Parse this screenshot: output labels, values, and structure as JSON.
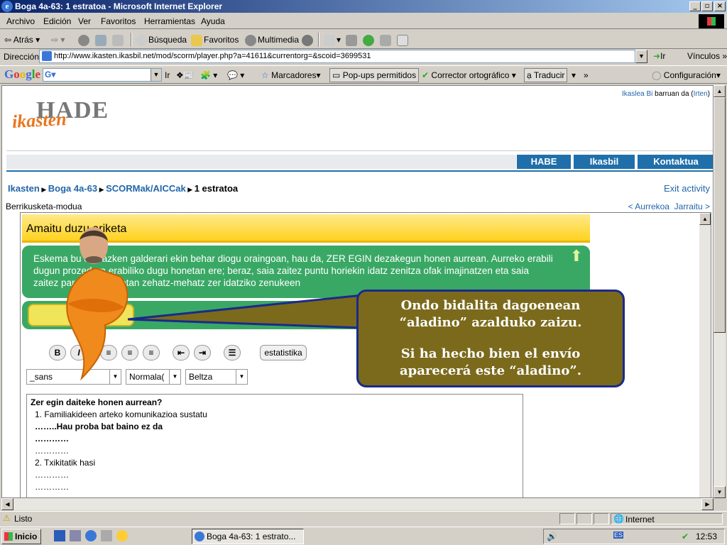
{
  "window": {
    "title": "Boga 4a-63: 1 estratoa - Microsoft Internet Explorer",
    "controls": [
      "_",
      "▫",
      "×"
    ]
  },
  "menu": [
    "Archivo",
    "Edición",
    "Ver",
    "Favoritos",
    "Herramientas",
    "Ayuda"
  ],
  "toolbar": {
    "back": "Atrás",
    "search": "Búsqueda",
    "favorites": "Favoritos",
    "media": "Multimedia"
  },
  "address": {
    "label": "Dirección",
    "url": "http://www.ikasten.ikasbil.net/mod/scorm/player.php?a=41611&currentorg=&scoid=3699531",
    "go": "Ir",
    "links": "Vínculos"
  },
  "google_bar": {
    "logo": "Google",
    "go": "Ir",
    "bookmarks": "Marcadores",
    "popups": "Pop-ups permitidos",
    "spell": "Corrector ortográfico",
    "translate": "Traducir",
    "settings": "Configuración"
  },
  "site": {
    "logo_hade": "HADE",
    "logo_ikasten": "ikasten",
    "user_prefix": "Ikaslea Bi",
    "user_mid": "barruan da (",
    "logout": "Irten",
    "user_suffix": ")",
    "tabs": [
      "HABE",
      "Ikasbil",
      "Kontaktua"
    ],
    "breadcrumbs": [
      "Ikasten",
      "Boga 4a-63",
      "SCORMak/AICCak",
      "1 estratoa"
    ],
    "exit": "Exit activity",
    "mode": "Berrikusketa-modua",
    "prev": "< Aurrekoa",
    "next": "Jarraitu >"
  },
  "lesson": {
    "header": "Amaitu duzu ariketa",
    "instruction": "Eskema bu      eko azken galderari ekin behar diogu oraingoan, hau da, ZER EGIN dezakegun honen aurrean. Aurreko         erabili dugun prozedura erabiliko dugu honetan ere; beraz, saia zaitez puntu horiekin idatz zenitza            ofak imajinatzen eta saia zaitez paragrafo horietan zehatz-mehatz zer idatziko zenukeen",
    "stat_button": "estatistika",
    "font_select": "_sans",
    "size_select": "Normala(",
    "color_select": "Beltza",
    "editor_lines": [
      {
        "text": "Zer egin daiteke honen aurrean?",
        "bold": true
      },
      {
        "text": "1. Familiakideen arteko komunikazioa sustatu",
        "bold": false
      },
      {
        "text": "……..Hau proba bat baino ez da",
        "bold": true
      },
      {
        "text": "…………",
        "bold": true
      },
      {
        "text": "…………",
        "bold": false
      },
      {
        "text": "2. Txikitatik hasi",
        "bold": false
      },
      {
        "text": "…………",
        "bold": false
      },
      {
        "text": "…………",
        "bold": false
      }
    ]
  },
  "callout": {
    "line1": "Ondo bidalita dagoenean “aladino” azalduko zaizu.",
    "line2": "Si ha hecho bien el envío aparecerá este “aladino”."
  },
  "status": {
    "text": "Listo",
    "zone": "Internet"
  },
  "taskbar": {
    "start": "Inicio",
    "task": "Boga 4a-63: 1 estrato...",
    "clock": "12:53"
  }
}
